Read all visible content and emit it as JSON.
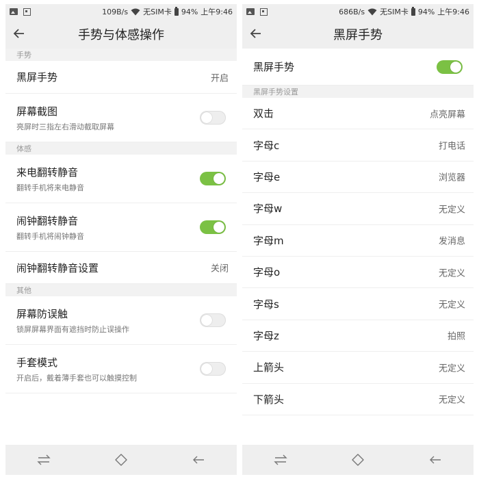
{
  "left": {
    "status": {
      "speed": "109B/s",
      "sim": "无SIM卡",
      "battery": "94%",
      "time": "上午9:46"
    },
    "title": "手势与体感操作",
    "sections": {
      "gesture": "手势",
      "motion": "体感",
      "other": "其他"
    },
    "black_screen_gesture": {
      "title": "黑屏手势",
      "value": "开启"
    },
    "screenshot": {
      "title": "屏幕截图",
      "sub": "亮屏时三指左右滑动截取屏幕",
      "on": false
    },
    "call_flip_mute": {
      "title": "来电翻转静音",
      "sub": "翻转手机将来电静音",
      "on": true
    },
    "alarm_flip_mute": {
      "title": "闹钟翻转静音",
      "sub": "翻转手机将闹钟静音",
      "on": true
    },
    "alarm_flip_mute_settings": {
      "title": "闹钟翻转静音设置",
      "value": "关闭"
    },
    "anti_mistouch": {
      "title": "屏幕防误触",
      "sub": "锁屏屏幕界面有遮挡时防止误操作",
      "on": false
    },
    "glove_mode": {
      "title": "手套模式",
      "sub": "开启后，戴着薄手套也可以触摸控制",
      "on": false
    }
  },
  "right": {
    "status": {
      "speed": "686B/s",
      "sim": "无SIM卡",
      "battery": "94%",
      "time": "上午9:46"
    },
    "title": "黑屏手势",
    "master": {
      "title": "黑屏手势",
      "on": true
    },
    "section": "黑屏手势设置",
    "items": [
      {
        "title": "双击",
        "value": "点亮屏幕"
      },
      {
        "title": "字母c",
        "value": "打电话"
      },
      {
        "title": "字母e",
        "value": "浏览器"
      },
      {
        "title": "字母w",
        "value": "无定义"
      },
      {
        "title": "字母m",
        "value": "发消息"
      },
      {
        "title": "字母o",
        "value": "无定义"
      },
      {
        "title": "字母s",
        "value": "无定义"
      },
      {
        "title": "字母z",
        "value": "拍照"
      },
      {
        "title": "上箭头",
        "value": "无定义"
      },
      {
        "title": "下箭头",
        "value": "无定义"
      }
    ]
  },
  "colors": {
    "toggle_on": "#7bc144",
    "toggle_off": "#eeeeee",
    "bar_background": "#efefef"
  },
  "icons": {
    "back": "arrow-left-icon",
    "nav_switch": "swap-arrows-icon",
    "nav_home": "diamond-home-icon",
    "nav_back": "back-arrow-icon"
  }
}
